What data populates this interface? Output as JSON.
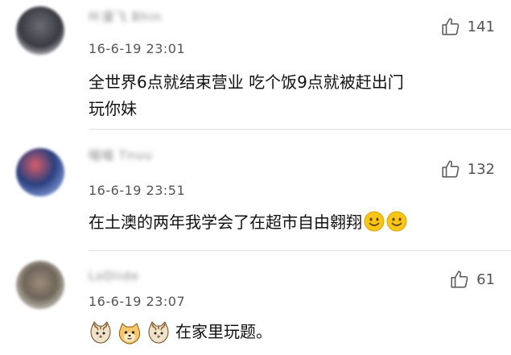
{
  "comments": [
    {
      "username": "叶漫飞 Bhin",
      "time": "16-6-19 23:01",
      "likes": "141",
      "text_line1": "全世界6点就结束营业 吃个饭9点就被赶出门",
      "text_line2": "玩你妹",
      "avatar_icon": "user-avatar-icon"
    },
    {
      "username": "喵喵 Tnuu",
      "time": "16-6-19 23:51",
      "likes": "132",
      "text": "在土澳的两年我学会了在超市自由翱翔",
      "emojis": [
        "smile-emoji-icon",
        "smile-emoji-icon"
      ],
      "avatar_icon": "user-avatar-icon"
    },
    {
      "username": "LoDiide",
      "time": "16-6-19 23:07",
      "likes": "61",
      "emojis": [
        "cat-emoji-icon",
        "dog-emoji-icon",
        "cat-emoji-icon"
      ],
      "text": "在家里玩题。",
      "avatar_icon": "user-avatar-icon"
    }
  ],
  "icons": {
    "like": "thumbs-up-icon"
  },
  "colors": {
    "background": "#ffffff",
    "meta_text": "#555555",
    "body_text": "#111111",
    "divider": "#e2e2e2",
    "emoji_yellow": "#f7c518"
  }
}
